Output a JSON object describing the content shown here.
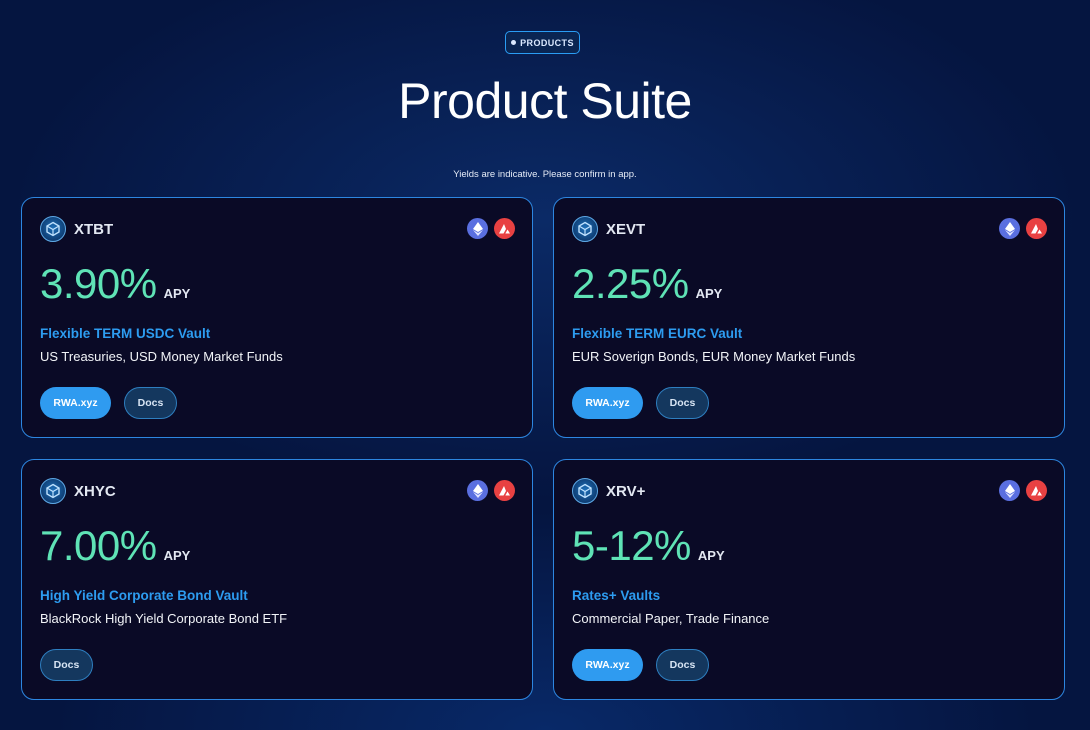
{
  "header": {
    "badge": "PRODUCTS",
    "title": "Product Suite",
    "note": "Yields are indicative. Please confirm in app."
  },
  "colors": {
    "background": "#051540",
    "card_bg": "#0a0a26",
    "card_border": "#2d86e0",
    "apy_green": "#5fe3b6",
    "vault_blue": "#2d9cf0",
    "primary_button": "#2f9bf0",
    "ethereum": "#5a6fe0",
    "avalanche": "#e84142"
  },
  "cards": [
    {
      "ticker": "XTBT",
      "apy": "3.90%",
      "apy_label": "APY",
      "vault_name": "Flexible TERM USDC Vault",
      "description": "US Treasuries, USD Money Market Funds",
      "chains": [
        "ethereum-icon",
        "avalanche-icon"
      ],
      "buttons": {
        "rwa": "RWA.xyz",
        "docs": "Docs"
      }
    },
    {
      "ticker": "XEVT",
      "apy": "2.25%",
      "apy_label": "APY",
      "vault_name": "Flexible TERM EURC Vault",
      "description": "EUR Soverign Bonds, EUR Money Market Funds",
      "chains": [
        "ethereum-icon",
        "avalanche-icon"
      ],
      "buttons": {
        "rwa": "RWA.xyz",
        "docs": "Docs"
      }
    },
    {
      "ticker": "XHYC",
      "apy": "7.00%",
      "apy_label": "APY",
      "vault_name": "High Yield Corporate Bond Vault",
      "description": "BlackRock High Yield Corporate Bond ETF",
      "chains": [
        "ethereum-icon",
        "avalanche-icon"
      ],
      "buttons": {
        "docs": "Docs"
      }
    },
    {
      "ticker": "XRV+",
      "apy": "5-12%",
      "apy_label": "APY",
      "vault_name": "Rates+ Vaults",
      "description": "Commercial Paper, Trade Finance",
      "chains": [
        "ethereum-icon",
        "avalanche-icon"
      ],
      "buttons": {
        "rwa": "RWA.xyz",
        "docs": "Docs"
      }
    }
  ]
}
